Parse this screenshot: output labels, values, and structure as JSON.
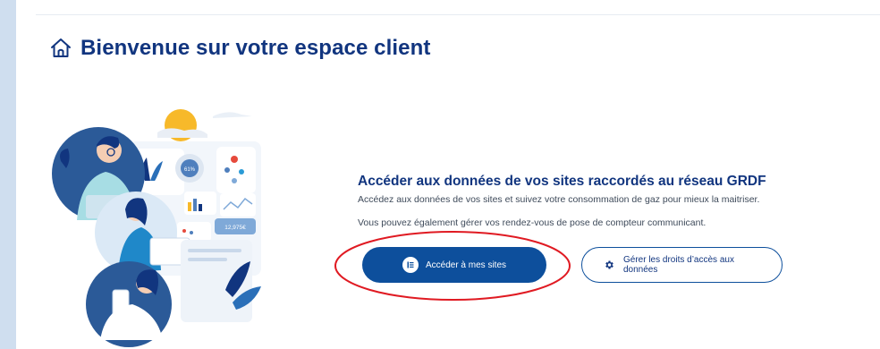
{
  "header": {
    "title": "Bienvenue sur votre espace client"
  },
  "main": {
    "section_title": "Accéder aux données de vos sites raccordés au réseau GRDF",
    "description": "Accédez aux données de vos sites et suivez votre consommation de gaz pour mieux la maitriser.",
    "description_2": "Vous pouvez également gérer vos rendez-vous de pose de compteur communicant.",
    "primary_button": "Accéder à mes sites",
    "secondary_button": "Gérer les droits d’accès aux données"
  },
  "illustration": {
    "gauge_text": "61%",
    "amount_text": "12,975€"
  },
  "colors": {
    "brand": "#11357f",
    "button": "#0d4f9c",
    "annotation": "#e01a22",
    "background": "#cfdeef"
  },
  "icons": {
    "title": "home-icon",
    "primary": "list-icon",
    "secondary": "gear-icon"
  }
}
